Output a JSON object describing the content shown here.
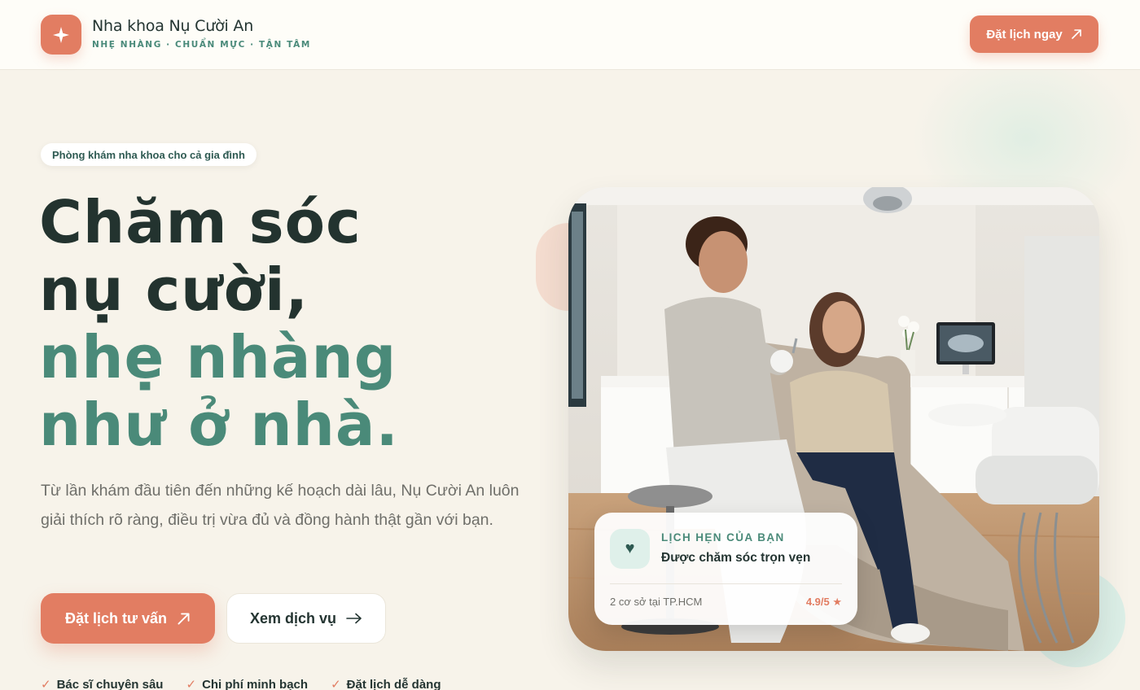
{
  "header": {
    "brand_name": "Nha khoa Nụ Cười An",
    "tagline": "NHẸ NHÀNG · CHUẨN MỰC · TẬN TÂM",
    "cta_label": "Đặt lịch ngay",
    "logo_icon": "sparkle-icon"
  },
  "hero": {
    "badge": "Phòng khám nha khoa cho cả gia đình",
    "headline": {
      "line1": "Chăm sóc",
      "line2": "nụ cười,",
      "line3": "nhẹ nhàng",
      "line4": "như ở nhà."
    },
    "lead": "Từ lần khám đầu tiên đến những kế hoạch dài lâu, Nụ Cười An luôn giải thích rõ ràng, điều trị vừa đủ và đồng hành thật gần với bạn.",
    "primary_cta": "Đặt lịch tư vấn",
    "secondary_cta": "Xem dịch vụ",
    "checks": [
      "Bác sĩ chuyên sâu",
      "Chi phí minh bạch",
      "Đặt lịch dễ dàng"
    ]
  },
  "appointment_card": {
    "label": "LỊCH HẸN CỦA BẠN",
    "title": "Được chăm sóc trọn vẹn",
    "location": "2 cơ sở tại TP.HCM",
    "rating": "4.9/5 ★",
    "icon": "heart-icon"
  },
  "colors": {
    "accent": "#e27d62",
    "green": "#4a8a79",
    "dark": "#23332f",
    "background": "#f7f3ea"
  }
}
